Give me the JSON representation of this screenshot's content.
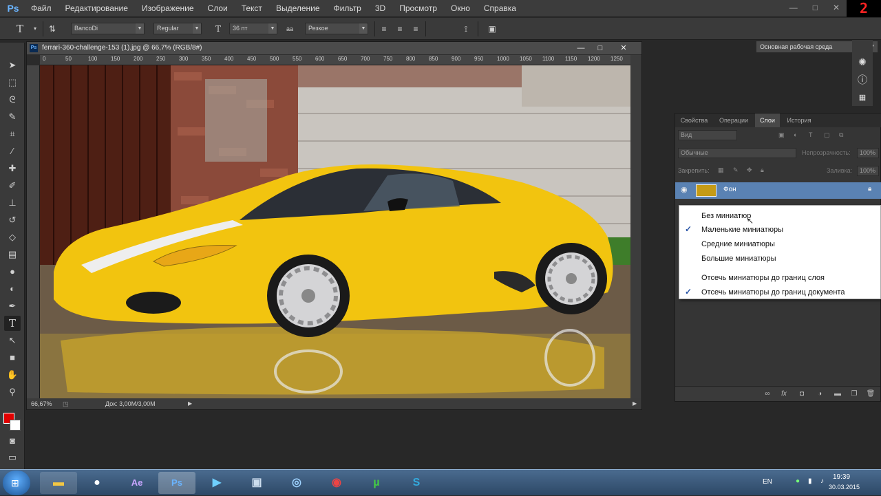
{
  "app": {
    "logo": "Ps"
  },
  "menu": [
    "Файл",
    "Редактирование",
    "Изображение",
    "Слои",
    "Текст",
    "Выделение",
    "Фильтр",
    "3D",
    "Просмотр",
    "Окно",
    "Справка"
  ],
  "window_controls": {
    "minimize": "—",
    "maximize": "□",
    "close": "✕"
  },
  "clock_overlay": "2",
  "options": {
    "font_family": "BancoDi",
    "font_style": "Regular",
    "font_size": "36 пт",
    "antialias_label": "aa",
    "antialias": "Резкое",
    "text_color": "#e10000",
    "workspace": "Основная рабочая среда"
  },
  "document": {
    "title": "ferrari-360-challenge-153 (1).jpg @ 66,7% (RGB/8#)",
    "zoom": "66,67%",
    "doc_size": "Док: 3,00M/3,00M",
    "ruler_ticks": [
      "0",
      "50",
      "100",
      "150",
      "200",
      "250",
      "300",
      "350",
      "400",
      "450",
      "500",
      "550",
      "600",
      "650",
      "700",
      "750",
      "800",
      "850",
      "900",
      "950",
      "1000",
      "1050",
      "1100",
      "1150",
      "1200",
      "1250"
    ]
  },
  "layers_panel": {
    "tabs": [
      "Свойства",
      "Операции",
      "Слои",
      "История"
    ],
    "active_tab": "Слои",
    "filter_kind": "Вид",
    "blend_mode": "Обычные",
    "opacity_label": "Непрозрачность:",
    "opacity_value": "100%",
    "lock_label": "Закрепить:",
    "fill_label": "Заливка:",
    "fill_value": "100%",
    "layer_name": "Фон"
  },
  "context_menu": {
    "items": [
      {
        "label": "Без миниатюр",
        "checked": false
      },
      {
        "label": "Маленькие миниатюры",
        "checked": true
      },
      {
        "label": "Средние миниатюры",
        "checked": false
      },
      {
        "label": "Большие миниатюры",
        "checked": false
      },
      {
        "label": "Отсечь миниатюры до границ слоя",
        "checked": false
      },
      {
        "label": "Отсечь миниатюры до границ документа",
        "checked": true
      }
    ]
  },
  "taskbar": {
    "apps": [
      "folder",
      "steam",
      "Ae",
      "Ps",
      "media",
      "terminal",
      "cinema4d",
      "chrome",
      "utorrent",
      "skype"
    ],
    "language": "EN",
    "time": "19:39",
    "date": "30.03.2015"
  }
}
